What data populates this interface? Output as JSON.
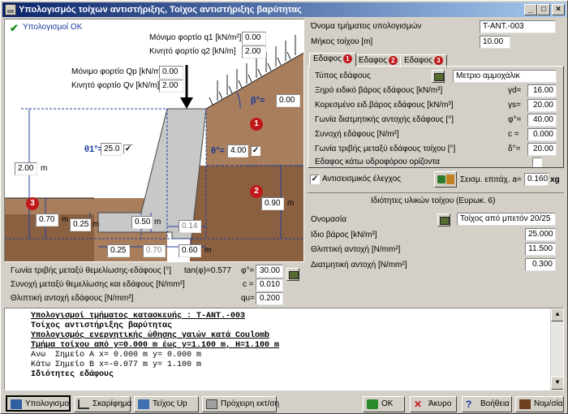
{
  "window": {
    "title": "Υπολογισμός τοίχων αντιστήριξης, Τοίχος αντιστήριξης βαρύτητας"
  },
  "status": {
    "ok_label": "Υπολογισμοί ΟΚ"
  },
  "drawing": {
    "q1_label": "Μόνιμο φορτίο q1 [kN/m²]",
    "q1_value": "0.00",
    "q2_label": "Κινητό φορτίο q2 [kN/m]",
    "q2_value": "2.00",
    "qp_label": "Μόνιμο φορτίο Qp [kN/m]",
    "qp_value": "0.00",
    "qv_label": "Κινητό φορτίο Qv [kN/m]",
    "qv_value": "2.00",
    "beta_label": "β°=",
    "beta_value": "0.00",
    "theta1_label": "θ1°=",
    "theta1_value": "25.0",
    "theta_label": "θ°=",
    "theta_value": "4.00",
    "h_total": "2.00",
    "h_total_unit": "m",
    "h_toe": "0.70",
    "h_toe_unit": "m",
    "h_base": "0.25",
    "h_base_unit": "m",
    "h_step": "0.50",
    "h_step_unit": "m",
    "w_top": "0.14",
    "h_water": "0.90",
    "h_water_unit": "m",
    "w_b1": "0.25",
    "w_b2": "0.70",
    "w_b3": "0.60",
    "w_b3_unit": "m",
    "marker1": "1",
    "marker2": "2",
    "marker3": "3"
  },
  "foundation": {
    "friction_label": "Γωνία τριβής μεταξύ θεμελίωσης-εδάφους [°]",
    "tan_label": "tan(φ)=0.577",
    "phi_label": "φ°=",
    "phi_value": "30.00",
    "cohesion_label": "Συνοχή μεταξύ θεμελίωσης και εδάφους [N/mm²]",
    "c_label": "c =",
    "c_value": "0.010",
    "bearing_label": "Θλιπτική αντοχή εδάφους [N/mm²]",
    "qu_label": "qu=",
    "qu_value": "0.200"
  },
  "section": {
    "name_label": "Όνομα τμήματος υπολογισμών",
    "name_value": "T-ANT.-003",
    "length_label": "Μήκος τοίχου [m]",
    "length_value": "10.00"
  },
  "tabs": [
    {
      "label": "Εδαφος",
      "num": "1"
    },
    {
      "label": "Εδαφος",
      "num": "2"
    },
    {
      "label": "Εδαφος",
      "num": "3"
    }
  ],
  "soil": {
    "type_label": "Τύπος εδάφους",
    "type_value": "Μετριο αμμοχάλικ",
    "dry_label": "Ξηρό ειδικό βάρος εδάφους [kN/m³]",
    "dry_sym": "γd=",
    "dry_value": "16.00",
    "sat_label": "Κορεσμένο ειδ.βάρος εδάφους [kN/m³]",
    "sat_sym": "γs=",
    "sat_value": "20.00",
    "phi_label": "Γωνία διατμητικής αντοχής εδάφους [°]",
    "phi_sym": "φ°=",
    "phi_value": "40.00",
    "c_label": "Συνοχή εδάφους [N/m²]",
    "c_sym": "c =",
    "c_value": "0.000",
    "delta_label": "Γωνία τριβής μεταξύ εδάφους τοίχου [°]",
    "delta_sym": "δ°=",
    "delta_value": "20.00",
    "water_label": "Εδαφος κάτω υδροφόρου ορίζοντα"
  },
  "seismic": {
    "label": "Αντισεισμικός έλεγχος",
    "accel_label": "Σεισμ. επιτάχ. a=",
    "accel_value": "0.160",
    "accel_unit": "xg"
  },
  "material": {
    "header": "Ιδιότητες υλικών τοίχου (Ευρωκ. 6)",
    "name_label": "Ονομασία",
    "name_value": "Τοίχος από μπετόν 20/25",
    "weight_label": "Ιδιο βάρος [kN/m³]",
    "weight_value": "25.000",
    "comp_label": "Θλιπτική αντοχή [N/mm²]",
    "comp_value": "11.500",
    "shear_label": "Διατμητική αντοχή [N/mm²]",
    "shear_value": "0.300"
  },
  "console": {
    "lines": [
      "Υπολογισμοί τμήματος κατασκευής : T-ANT.-003",
      "Τοίχος αντιστήριξης βαρύτητας",
      "Υπολογισμός ενεργητικής ώθησης γαιών κατά Coulomb",
      "Τμήμα τοίχου από y=0.000 m έως y=1.100 m, H=1.100 m",
      "Ανω  Σημείο A x= 0.000 m y= 0.000 m",
      "Κάτω Σημείο B x=-0.077 m y= 1.100 m",
      "Ιδιότητες εδάφους"
    ]
  },
  "buttons": {
    "calc": "Υπολογισμοί",
    "sketch": "Σκαρίφημα",
    "wallup": "Τείχος Up",
    "draft": "Πρόχειρη εκτ/ση",
    "ok": "OK",
    "cancel": "Άκυρο",
    "help": "Βοήθεια",
    "norms": "Νομ/σία"
  },
  "colors": {
    "earth": "#a97e5c",
    "earth_dark": "#7b5538",
    "sky": "#ffffff",
    "accent": "#0a246a",
    "marker": "#c0181a"
  }
}
